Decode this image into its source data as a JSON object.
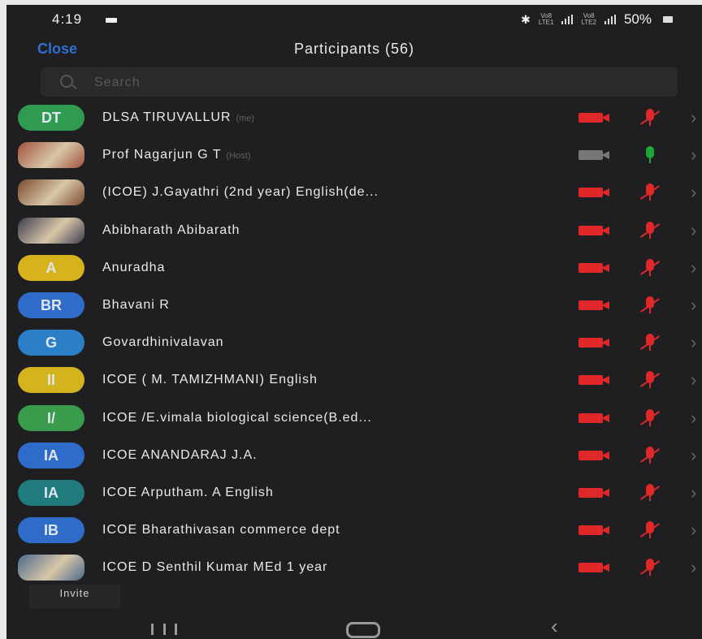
{
  "status_bar": {
    "time": "4:19",
    "sim1": "Vo8\nLTE1",
    "sim2": "Vo8\nLTE2",
    "battery": "50%"
  },
  "header": {
    "close_label": "Close",
    "title": "Participants (56)"
  },
  "search": {
    "placeholder": "Search",
    "value": ""
  },
  "colors": {
    "muted_red": "#e0282a",
    "active_green": "#1fa63a",
    "camera_off_gray": "#777777"
  },
  "participants": [
    {
      "initials": "DT",
      "avatar_color": "#2f9b50",
      "name": "DLSA TIRUVALLUR",
      "tag": "(me)",
      "camera": "off",
      "mic": "muted"
    },
    {
      "initials": "",
      "avatar_color": "#a0503c",
      "photo": true,
      "name": "Prof Nagarjun G T",
      "tag": "(Host)",
      "camera": "off-gray",
      "mic": "on"
    },
    {
      "initials": "",
      "avatar_color": "#7c4a2f",
      "photo": true,
      "name": "(ICOE) J.Gayathri (2nd year) English(de...",
      "tag": "",
      "camera": "off",
      "mic": "muted"
    },
    {
      "initials": "",
      "avatar_color": "#3c3c50",
      "photo": true,
      "name": "Abibharath Abibarath",
      "tag": "",
      "camera": "off",
      "mic": "muted"
    },
    {
      "initials": "A",
      "avatar_color": "#d6b21c",
      "name": "Anuradha",
      "tag": "",
      "camera": "off",
      "mic": "muted"
    },
    {
      "initials": "BR",
      "avatar_color": "#2f6cc9",
      "name": "Bhavani R",
      "tag": "",
      "camera": "off",
      "mic": "muted"
    },
    {
      "initials": "G",
      "avatar_color": "#2a7fc7",
      "name": "Govardhinivalavan",
      "tag": "",
      "camera": "off",
      "mic": "muted"
    },
    {
      "initials": "II",
      "avatar_color": "#d4b41e",
      "name": "ICOE ( M. TAMIZHMANI) English",
      "tag": "",
      "camera": "off",
      "mic": "muted"
    },
    {
      "initials": "I/",
      "avatar_color": "#3a9b4c",
      "name": "ICOE /E.vimala biological science(B.ed...",
      "tag": "",
      "camera": "off",
      "mic": "muted"
    },
    {
      "initials": "IA",
      "avatar_color": "#2f6cc9",
      "name": "ICOE ANANDARAJ  J.A.",
      "tag": "",
      "camera": "off",
      "mic": "muted"
    },
    {
      "initials": "IA",
      "avatar_color": "#1f7b7c",
      "name": "ICOE Arputham. A English",
      "tag": "",
      "camera": "off",
      "mic": "muted"
    },
    {
      "initials": "IB",
      "avatar_color": "#2f6cc9",
      "name": "ICOE Bharathivasan commerce dept",
      "tag": "",
      "camera": "off",
      "mic": "muted"
    },
    {
      "initials": "",
      "avatar_color": "#4a6a8c",
      "photo": true,
      "name": "ICOE D Senthil Kumar MEd 1 year",
      "tag": "",
      "camera": "off",
      "mic": "muted"
    }
  ],
  "footer": {
    "invite_label": "Invite"
  },
  "icons": {
    "camera": "video-camera-off-icon",
    "mic_muted": "microphone-muted-icon",
    "mic_on": "microphone-icon",
    "chevron": "chevron-right-icon",
    "search": "search-icon"
  }
}
